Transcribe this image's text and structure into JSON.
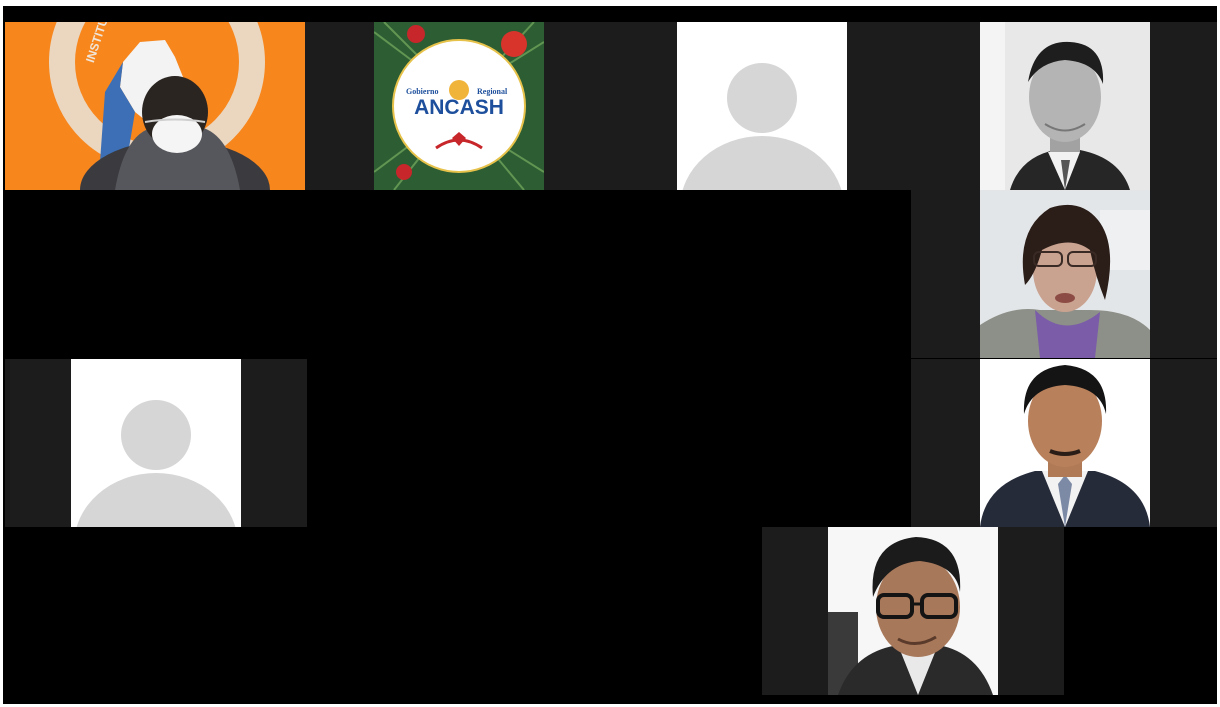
{
  "meeting": {
    "tiles": [
      {
        "id": "inst",
        "type": "video",
        "logo_text": "INSTITUTO NACIONAL DE DEFENSA"
      },
      {
        "id": "ancash",
        "type": "profile-image",
        "logo_line1_left": "Gobierno",
        "logo_line1_right": "Regional",
        "logo_title": "ANCASH"
      },
      {
        "id": "placeholder-1",
        "type": "avatar-placeholder"
      },
      {
        "id": "man-bw",
        "type": "profile-photo"
      },
      {
        "id": "woman",
        "type": "video"
      },
      {
        "id": "placeholder-2",
        "type": "avatar-placeholder"
      },
      {
        "id": "man-suit",
        "type": "profile-photo"
      },
      {
        "id": "man-glasses",
        "type": "profile-photo"
      }
    ]
  },
  "colors": {
    "frame_bg": "#000000",
    "tile_bg": "#1c1c1c",
    "orange_bg": "#f7861d",
    "avatar_silhouette": "#d6d6d6",
    "ancash_blue": "#1d4f9c"
  }
}
